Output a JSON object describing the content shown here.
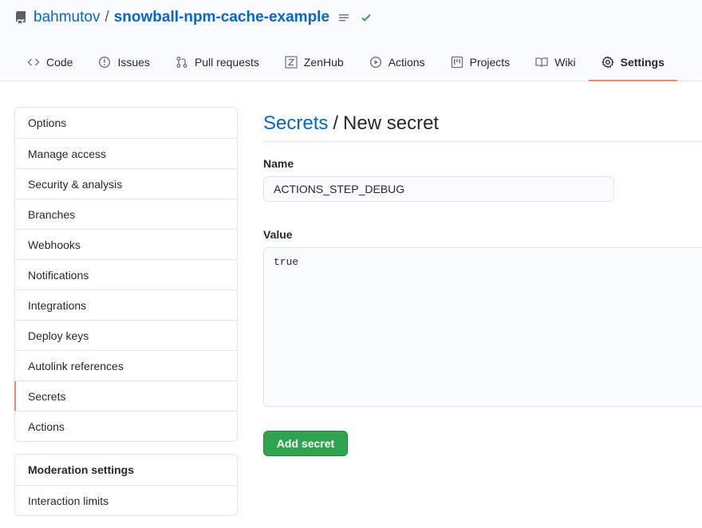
{
  "repo": {
    "owner": "bahmutov",
    "separator": "/",
    "name": "snowball-npm-cache-example"
  },
  "tabs": [
    {
      "label": "Code",
      "icon": "code-icon"
    },
    {
      "label": "Issues",
      "icon": "issue-icon"
    },
    {
      "label": "Pull requests",
      "icon": "pull-request-icon"
    },
    {
      "label": "ZenHub",
      "icon": "zenhub-icon"
    },
    {
      "label": "Actions",
      "icon": "play-icon"
    },
    {
      "label": "Projects",
      "icon": "project-icon"
    },
    {
      "label": "Wiki",
      "icon": "book-icon"
    },
    {
      "label": "Settings",
      "icon": "gear-icon",
      "selected": true
    }
  ],
  "sidebar": {
    "items": [
      {
        "label": "Options"
      },
      {
        "label": "Manage access"
      },
      {
        "label": "Security & analysis"
      },
      {
        "label": "Branches"
      },
      {
        "label": "Webhooks"
      },
      {
        "label": "Notifications"
      },
      {
        "label": "Integrations"
      },
      {
        "label": "Deploy keys"
      },
      {
        "label": "Autolink references"
      },
      {
        "label": "Secrets",
        "selected": true
      },
      {
        "label": "Actions"
      }
    ],
    "moderation_heading": "Moderation settings",
    "moderation_items": [
      {
        "label": "Interaction limits"
      }
    ]
  },
  "main": {
    "breadcrumb_link": "Secrets",
    "breadcrumb_sep": "/",
    "title": "New secret",
    "name_label": "Name",
    "name_value": "ACTIONS_STEP_DEBUG",
    "value_label": "Value",
    "value_value": "true",
    "submit_label": "Add secret"
  },
  "colors": {
    "link": "#0366d6",
    "accent_underline": "#f9826c",
    "primary_button": "#2ea44f",
    "status_check": "#28a745"
  }
}
